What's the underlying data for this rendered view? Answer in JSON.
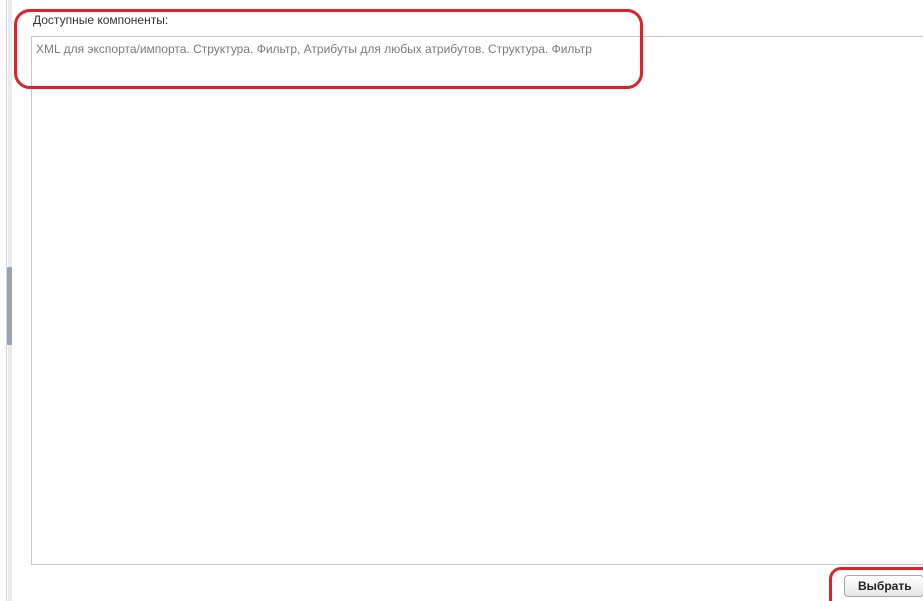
{
  "components": {
    "label": "Доступные компоненты:",
    "items": [
      "XML для экспорта/импорта. Структура. Фильтр, Атрибуты для любых атрибутов. Структура. Фильтр"
    ]
  },
  "actions": {
    "select_label": "Выбрать"
  },
  "colors": {
    "highlight": "#e0202a",
    "border": "#c9c9c9",
    "item_text": "#7b7b7b"
  }
}
